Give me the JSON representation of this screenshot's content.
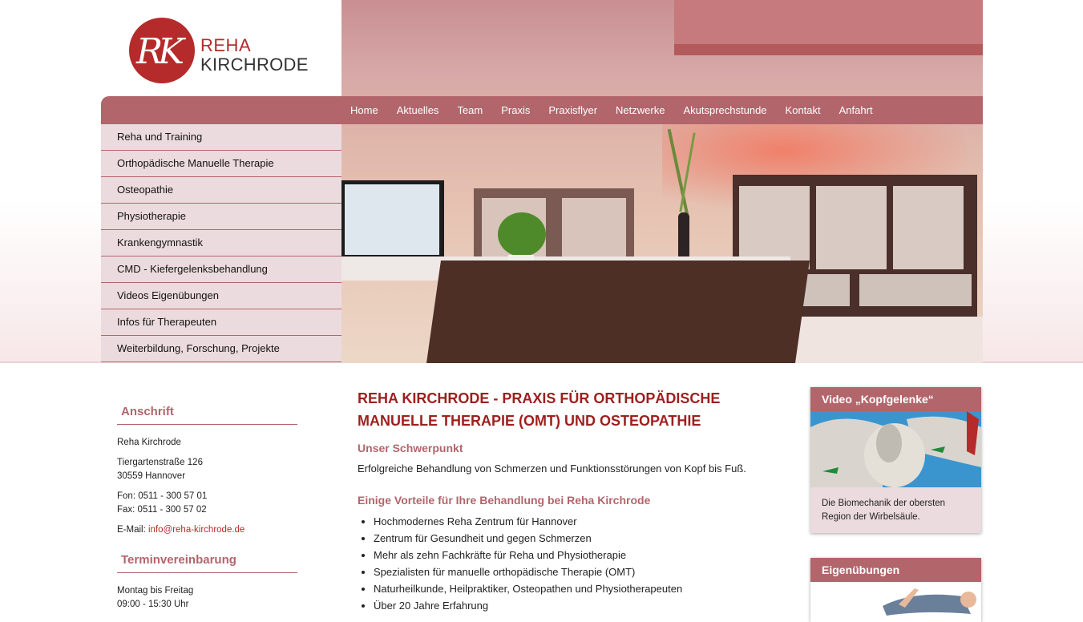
{
  "logo": {
    "monogram": "RK",
    "line1": "REHA",
    "line2": "KIRCHRODE"
  },
  "nav": [
    "Home",
    "Aktuelles",
    "Team",
    "Praxis",
    "Praxisflyer",
    "Netzwerke",
    "Akutsprechstunde",
    "Kontakt",
    "Anfahrt"
  ],
  "leftmenu": [
    "Reha und Training",
    "Orthopädische Manuelle Therapie",
    "Osteopathie",
    "Physiotherapie",
    "Krankengymnastik",
    "CMD - Kiefergelenksbehandlung",
    "Videos Eigenübungen",
    "Infos für Therapeuten",
    "Weiterbildung, Forschung, Projekte"
  ],
  "address": {
    "heading": "Anschrift",
    "name": "Reha Kirchrode",
    "street": "Tiergartenstraße 126",
    "city": "30559 Hannover",
    "phone": "Fon: 0511 - 300 57 01",
    "fax": "Fax: 0511 - 300 57 02",
    "email_label": "E-Mail: ",
    "email": "info@reha-kirchrode.de"
  },
  "appointment": {
    "heading": "Terminvereinbarung",
    "days": "Montag bis Freitag",
    "hours": "09:00 - 15:30 Uhr"
  },
  "main": {
    "title": "Reha Kirchrode - Praxis für orthopädische manuelle Therapie (OMT) und Osteopathie",
    "focus_heading": "Unser Schwerpunkt",
    "focus_text": "Erfolgreiche Behandlung von Schmerzen und Funktionsstörungen von Kopf bis Fuß.",
    "advantages_heading": "Einige Vorteile für Ihre Behandlung bei Reha Kirchrode",
    "advantages": [
      "Hochmodernes Reha Zentrum für Hannover",
      "Zentrum für Gesundheit und gegen Schmerzen",
      "Mehr als zehn Fachkräfte für Reha und Physiotherapie",
      "Spezialisten für manuelle orthopädische Therapie (OMT)",
      "Naturheilkunde, Heilpraktiker, Osteopathen und Physiotherapeuten",
      "Über 20 Jahre Erfahrung"
    ]
  },
  "video_box": {
    "title": "Video „Kopfgelenke“",
    "text": "Die Biomechanik der obersten Region der Wirbelsäule."
  },
  "exercise_box": {
    "title": "Eigenübungen"
  }
}
